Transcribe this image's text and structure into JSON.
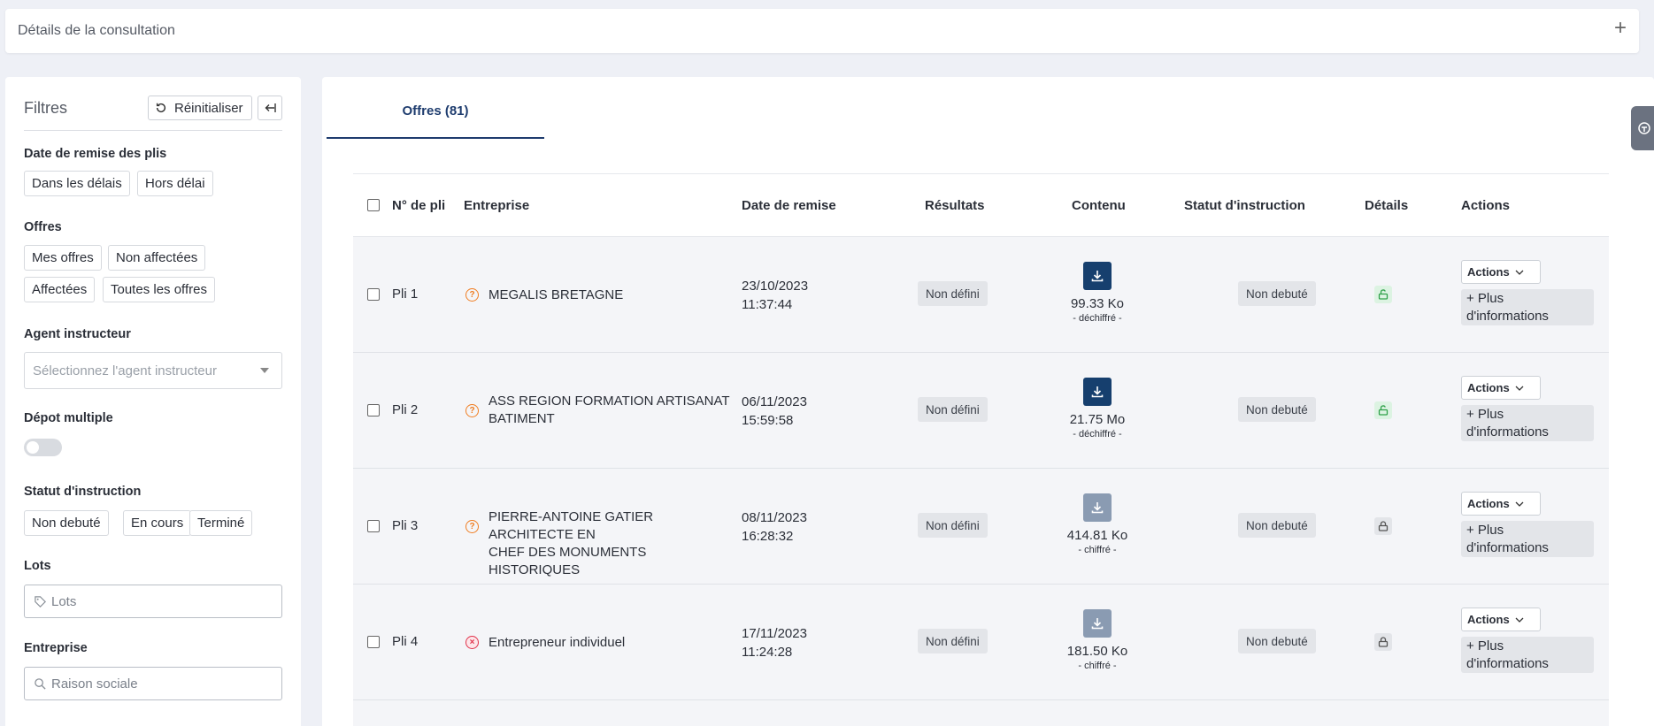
{
  "header": {
    "title": "Détails de la consultation",
    "expand_icon": "+"
  },
  "sidebar": {
    "title": "Filtres",
    "reset_label": "Réinitialiser",
    "sections": {
      "date_remise": {
        "label": "Date de remise des plis",
        "options": [
          "Dans les délais",
          "Hors délai"
        ]
      },
      "offres": {
        "label": "Offres",
        "options": [
          "Mes offres",
          "Non affectées",
          "Affectées",
          "Toutes les offres"
        ]
      },
      "agent": {
        "label": "Agent instructeur",
        "placeholder": "Sélectionnez l'agent instructeur"
      },
      "depot": {
        "label": "Dépot multiple",
        "toggle_on": false
      },
      "statut": {
        "label": "Statut d'instruction",
        "options": [
          "Non debuté",
          "En cours",
          "Terminé"
        ]
      },
      "lots": {
        "label": "Lots",
        "placeholder": "Lots"
      },
      "entreprise": {
        "label": "Entreprise",
        "placeholder": "Raison sociale"
      }
    }
  },
  "tabs": [
    {
      "label": "Offres (81)",
      "active": true
    }
  ],
  "table": {
    "headers": {
      "num": "N° de pli",
      "entreprise": "Entreprise",
      "date": "Date de remise",
      "resultats": "Résultats",
      "contenu": "Contenu",
      "statut": "Statut d'instruction",
      "details": "Détails",
      "actions": "Actions"
    },
    "rows": [
      {
        "pli": "Pli 1",
        "company_line1": "MEGALIS BRETAGNE",
        "company_line2": "",
        "status_icon": "question-icon",
        "date": "23/10/2023",
        "time": "11:37:44",
        "result": "Non défini",
        "size": "99.33 Ko",
        "encryption": "- déchiffré -",
        "download_style": "dark",
        "statut": "Non debuté",
        "lock": "unlocked-lock-icon",
        "actions_label": "Actions",
        "more_line1": "+ Plus",
        "more_line2": "d'informations"
      },
      {
        "pli": "Pli 2",
        "company_line1": "ASS REGION FORMATION ARTISANAT",
        "company_line2": "BATIMENT",
        "status_icon": "question-icon",
        "date": "06/11/2023",
        "time": "15:59:58",
        "result": "Non défini",
        "size": "21.75 Mo",
        "encryption": "- déchiffré -",
        "download_style": "dark",
        "statut": "Non debuté",
        "lock": "unlocked-lock-icon",
        "actions_label": "Actions",
        "more_line1": "+ Plus",
        "more_line2": "d'informations"
      },
      {
        "pli": "Pli 3",
        "company_line1": "PIERRE-ANTOINE GATIER ARCHITECTE EN",
        "company_line2": "CHEF DES MONUMENTS HISTORIQUES",
        "status_icon": "question-icon",
        "date": "08/11/2023",
        "time": "16:28:32",
        "result": "Non défini",
        "size": "414.81 Ko",
        "encryption": "- chiffré -",
        "download_style": "light",
        "statut": "Non debuté",
        "lock": "locked-lock-icon",
        "actions_label": "Actions",
        "more_line1": "+ Plus",
        "more_line2": "d'informations"
      },
      {
        "pli": "Pli 4",
        "company_line1": "Entrepreneur individuel",
        "company_line2": "",
        "status_icon": "error-x-icon",
        "date": "17/11/2023",
        "time": "11:24:28",
        "result": "Non défini",
        "size": "181.50 Ko",
        "encryption": "- chiffré -",
        "download_style": "light",
        "statut": "Non debuté",
        "lock": "locked-lock-icon",
        "actions_label": "Actions",
        "more_line1": "+ Plus",
        "more_line2": "d'informations"
      }
    ]
  },
  "colors": {
    "primary": "#163f6e",
    "download_disabled": "#8a9bb2",
    "warning": "#f07d21",
    "error": "#e0324b",
    "unlocked": "#2fa14a",
    "badge_bg": "#e3e5e9"
  }
}
